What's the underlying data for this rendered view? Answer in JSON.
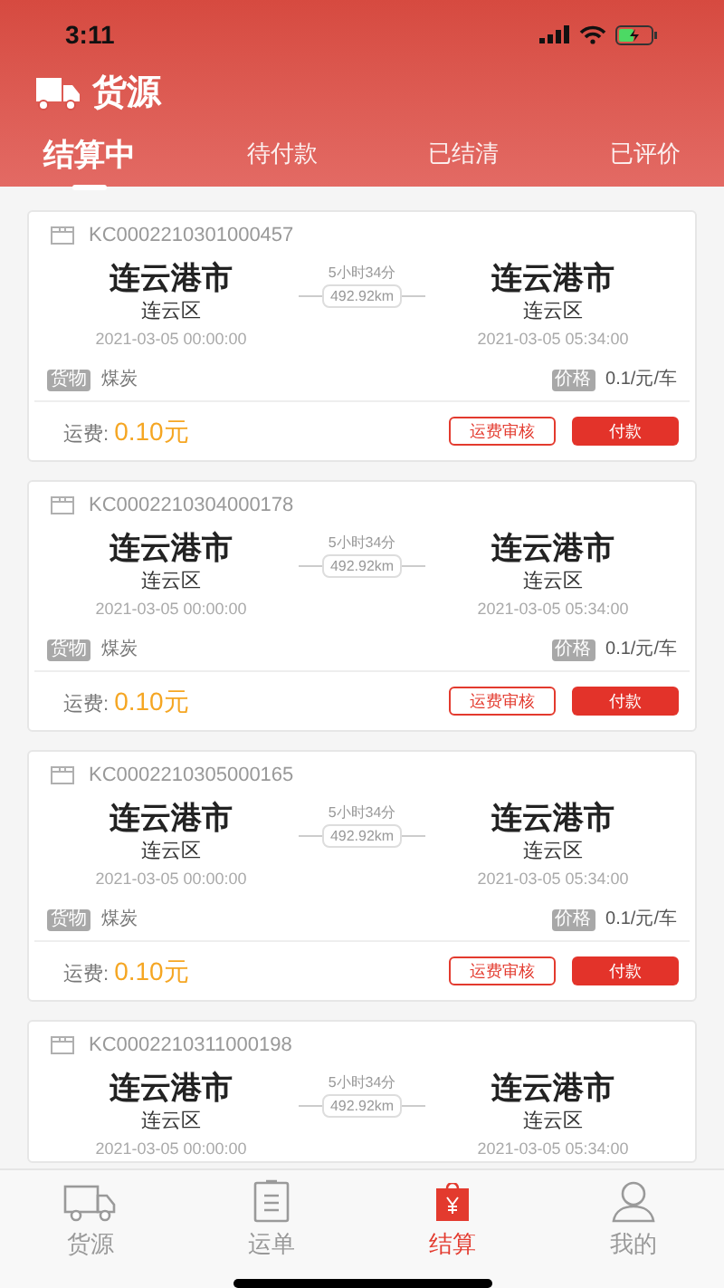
{
  "status_bar": {
    "time": "3:11"
  },
  "header": {
    "title": "货源"
  },
  "tabs": [
    {
      "label": "结算中",
      "selected": true
    },
    {
      "label": "待付款",
      "selected": false
    },
    {
      "label": "已结清",
      "selected": false
    },
    {
      "label": "已评价",
      "selected": false
    }
  ],
  "orders": [
    {
      "number": "KC0002210301000457",
      "from": {
        "city": "连云港市",
        "district": "连云区",
        "time": "2021-03-05 00:00:00"
      },
      "duration": "5小时34分",
      "distance": "492.92km",
      "to": {
        "city": "连云港市",
        "district": "连云区",
        "time": "2021-03-05 05:34:00"
      },
      "cargo_tag": "货物",
      "cargo": "煤炭",
      "price_tag": "价格",
      "price": "0.1/元/车",
      "fee_label": "运费:",
      "fee": "0.10元",
      "buttons": [
        "运费审核",
        "付款"
      ]
    },
    {
      "number": "KC0002210304000178",
      "from": {
        "city": "连云港市",
        "district": "连云区",
        "time": "2021-03-05 00:00:00"
      },
      "duration": "5小时34分",
      "distance": "492.92km",
      "to": {
        "city": "连云港市",
        "district": "连云区",
        "time": "2021-03-05 05:34:00"
      },
      "cargo_tag": "货物",
      "cargo": "煤炭",
      "price_tag": "价格",
      "price": "0.1/元/车",
      "fee_label": "运费:",
      "fee": "0.10元",
      "buttons": [
        "运费审核",
        "付款"
      ]
    },
    {
      "number": "KC0002210305000165",
      "from": {
        "city": "连云港市",
        "district": "连云区",
        "time": "2021-03-05 00:00:00"
      },
      "duration": "5小时34分",
      "distance": "492.92km",
      "to": {
        "city": "连云港市",
        "district": "连云区",
        "time": "2021-03-05 05:34:00"
      },
      "cargo_tag": "货物",
      "cargo": "煤炭",
      "price_tag": "价格",
      "price": "0.1/元/车",
      "fee_label": "运费:",
      "fee": "0.10元",
      "buttons": [
        "运费审核",
        "付款"
      ]
    },
    {
      "number": "KC0002210311000198",
      "from": {
        "city": "连云港市",
        "district": "连云区",
        "time": "2021-03-05 00:00:00"
      },
      "duration": "5小时34分",
      "distance": "492.92km",
      "to": {
        "city": "连云港市",
        "district": "连云区",
        "time": "2021-03-05 05:34:00"
      }
    }
  ],
  "bottom_nav": [
    {
      "kind": "truck",
      "label": "货源",
      "selected": false
    },
    {
      "kind": "clipboard",
      "label": "运单",
      "selected": false
    },
    {
      "kind": "bag",
      "label": "结算",
      "selected": true
    },
    {
      "kind": "person",
      "label": "我的",
      "selected": false
    }
  ]
}
